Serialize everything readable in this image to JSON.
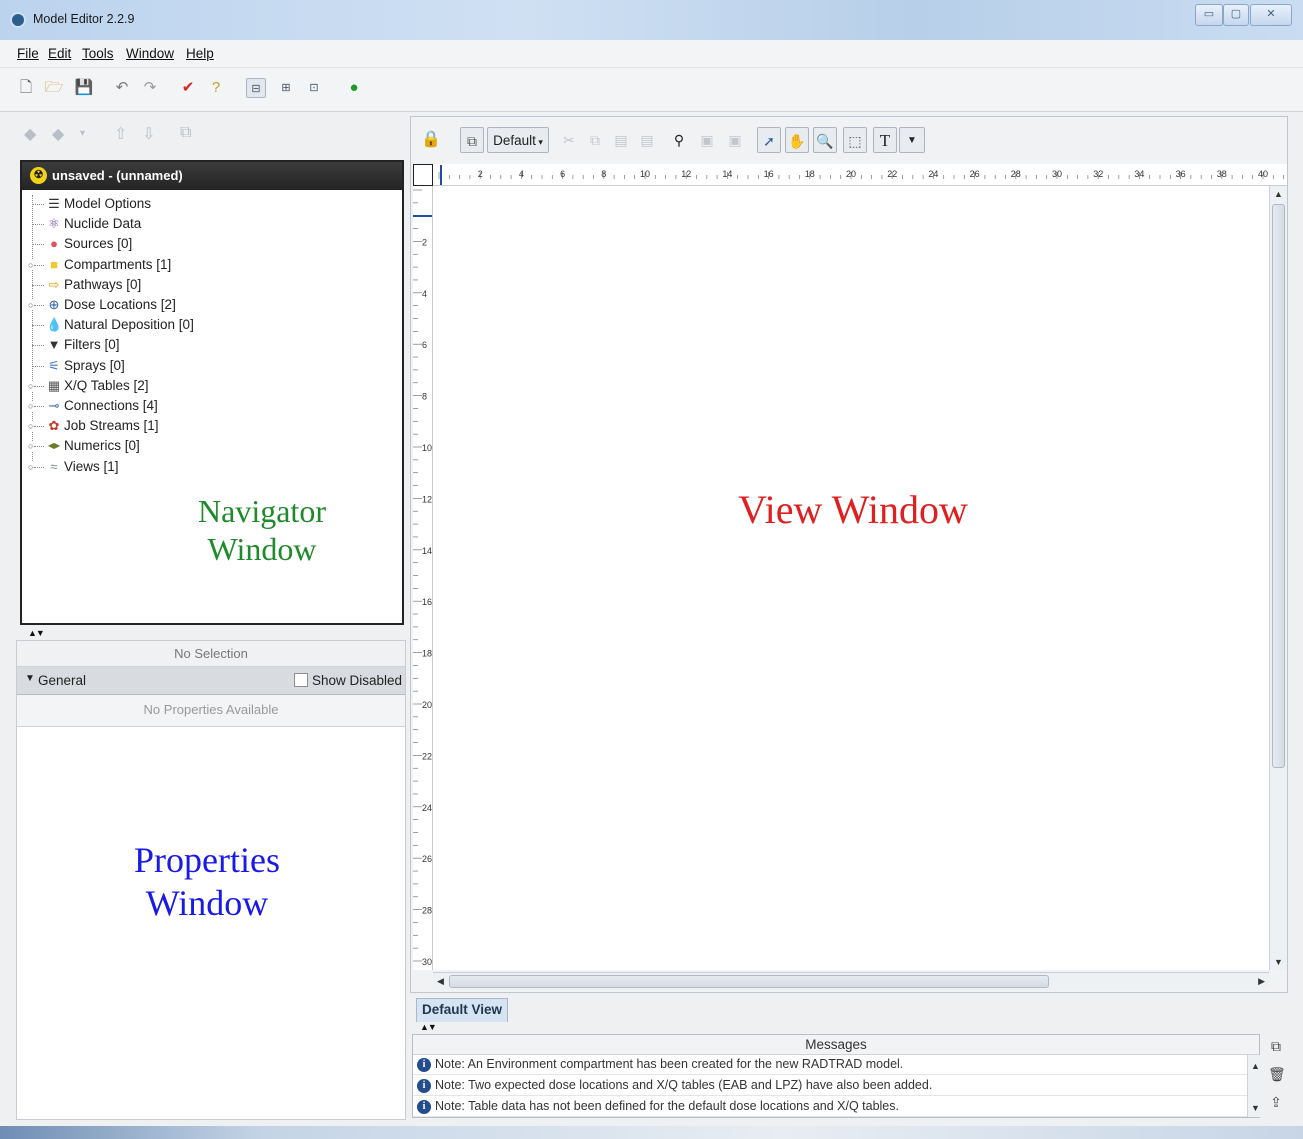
{
  "window": {
    "title": "Model Editor 2.2.9"
  },
  "menu": [
    "File",
    "Edit",
    "Tools",
    "Window",
    "Help"
  ],
  "navigator": {
    "header": "unsaved - (unnamed)",
    "items": [
      {
        "label": "Model Options",
        "icon": "options-icon",
        "expandable": false
      },
      {
        "label": "Nuclide Data",
        "icon": "nuclide-icon",
        "expandable": false
      },
      {
        "label": "Sources [0]",
        "icon": "source-icon",
        "expandable": false
      },
      {
        "label": "Compartments [1]",
        "icon": "compartment-icon",
        "expandable": true
      },
      {
        "label": "Pathways [0]",
        "icon": "pathway-icon",
        "expandable": false
      },
      {
        "label": "Dose Locations [2]",
        "icon": "dose-location-icon",
        "expandable": true
      },
      {
        "label": "Natural Deposition [0]",
        "icon": "deposition-icon",
        "expandable": false
      },
      {
        "label": "Filters [0]",
        "icon": "filter-icon",
        "expandable": false
      },
      {
        "label": "Sprays [0]",
        "icon": "spray-icon",
        "expandable": false
      },
      {
        "label": "X/Q Tables [2]",
        "icon": "table-icon",
        "expandable": true
      },
      {
        "label": "Connections [4]",
        "icon": "connection-icon",
        "expandable": true
      },
      {
        "label": "Job Streams [1]",
        "icon": "job-stream-icon",
        "expandable": true
      },
      {
        "label": "Numerics [0]",
        "icon": "numerics-icon",
        "expandable": true
      },
      {
        "label": "Views [1]",
        "icon": "view-icon",
        "expandable": true
      }
    ],
    "overlay_label": "Navigator\nWindow",
    "overlay_color": "#1f8a2a"
  },
  "properties": {
    "selection": "No Selection",
    "section": "General",
    "show_disabled": "Show Disabled",
    "empty": "No Properties Available",
    "overlay_label": "Properties\nWindow",
    "overlay_color": "#1a1ae6"
  },
  "view": {
    "style_select": "Default",
    "overlay_label": "View Window",
    "overlay_color": "#e02020",
    "ruler_top_labels": [
      "2",
      "4",
      "6",
      "8",
      "10",
      "12",
      "14",
      "16",
      "18",
      "20",
      "22",
      "24",
      "26",
      "28",
      "30",
      "32",
      "34",
      "36",
      "38",
      "40"
    ],
    "ruler_left_labels": [
      "2",
      "4",
      "6",
      "8",
      "10",
      "12",
      "14",
      "16",
      "18",
      "20",
      "22",
      "24",
      "26",
      "28",
      "30"
    ],
    "tab": "Default View"
  },
  "messages": {
    "header": "Messages",
    "rows": [
      "Note: An Environment compartment has been created for the new RADTRAD model.",
      "Note: Two expected dose locations and X/Q tables (EAB and LPZ) have also been added.",
      "Note: Table data has not been defined for the default dose locations and X/Q tables."
    ]
  }
}
